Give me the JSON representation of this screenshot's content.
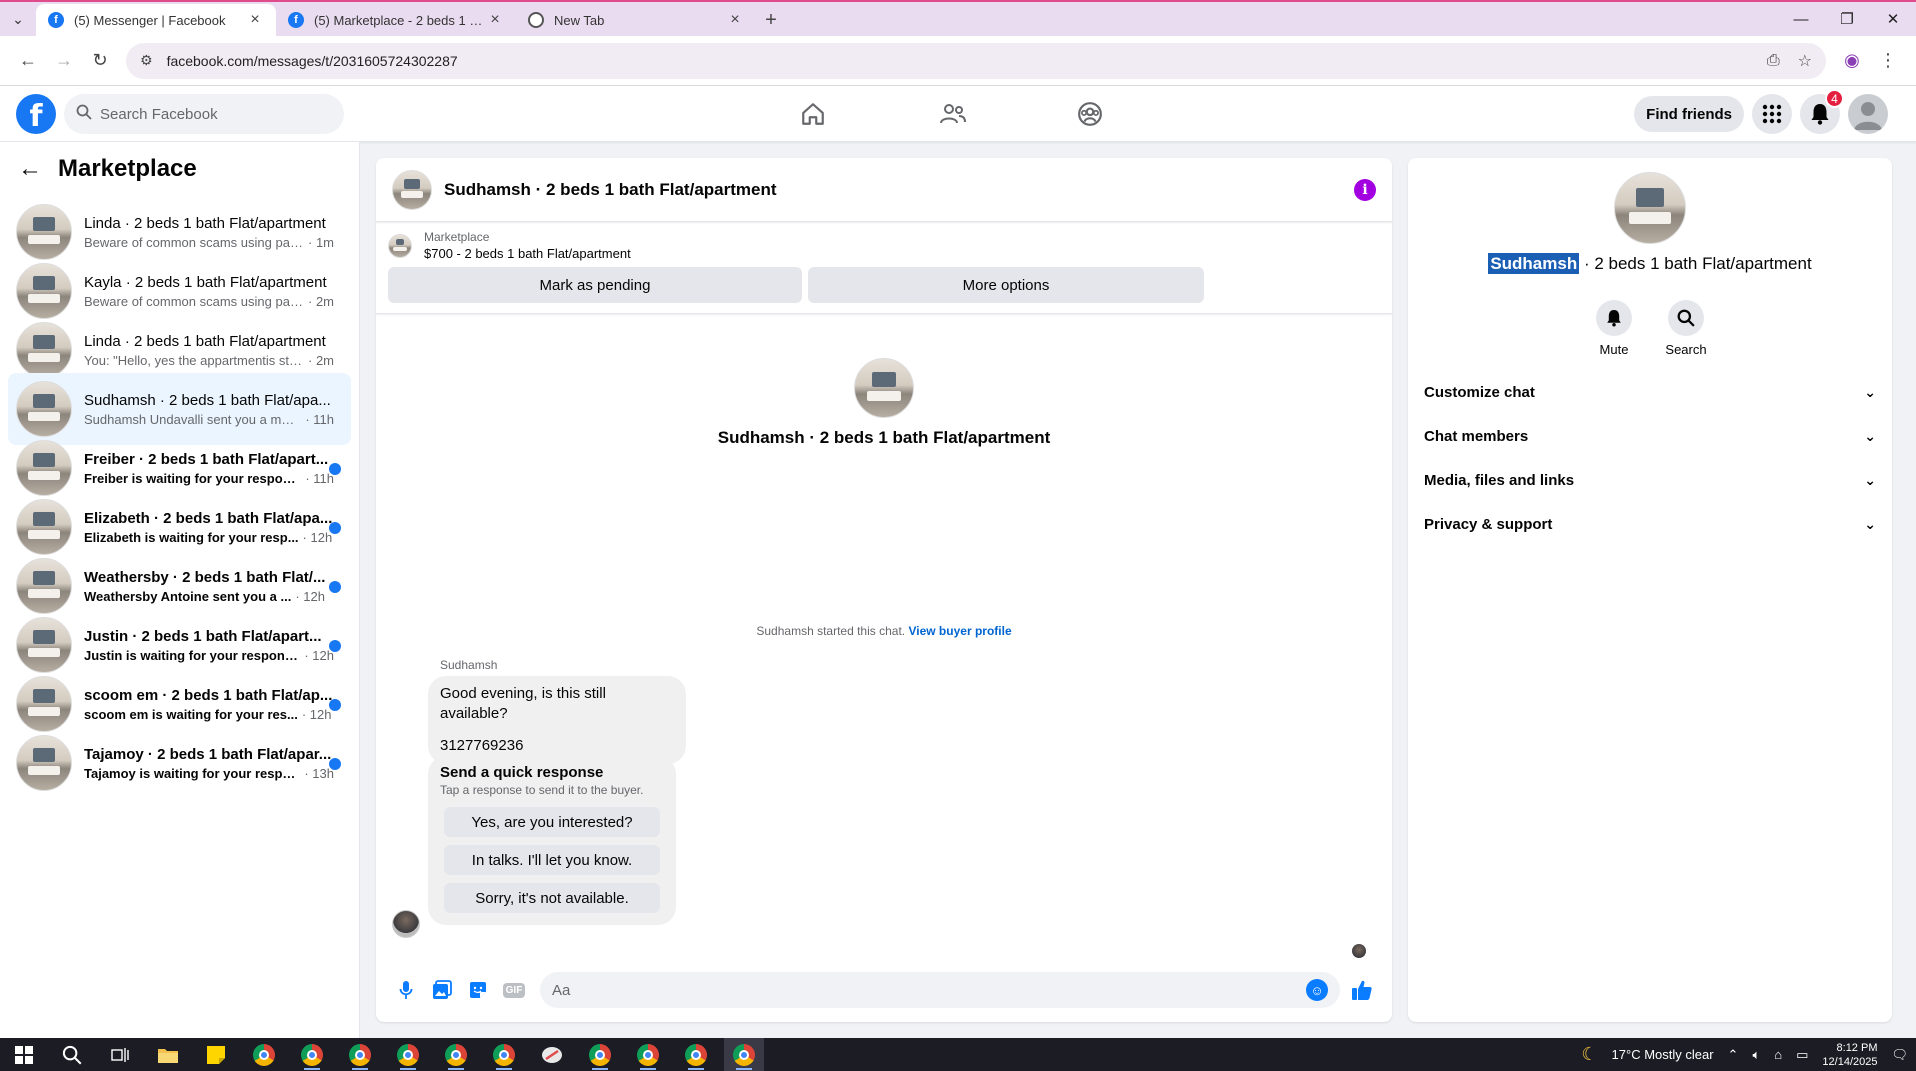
{
  "browser": {
    "tabs": [
      {
        "title": "(5) Messenger | Facebook",
        "active": true
      },
      {
        "title": "(5) Marketplace - 2 beds 1 bath",
        "active": false
      },
      {
        "title": "New Tab",
        "active": false
      }
    ],
    "url": "facebook.com/messages/t/2031605724302287"
  },
  "fb": {
    "search_placeholder": "Search Facebook",
    "find_friends": "Find friends",
    "notifications_count": "4"
  },
  "sidebar": {
    "title": "Marketplace",
    "conversations": [
      {
        "name": "Linda · 2 beds 1 bath Flat/apartment",
        "preview": "Beware of common scams using pay...",
        "time": "· 1m",
        "unread": false,
        "active": false
      },
      {
        "name": "Kayla · 2 beds 1 bath Flat/apartment",
        "preview": "Beware of common scams using pay...",
        "time": "· 2m",
        "unread": false,
        "active": false
      },
      {
        "name": "Linda · 2 beds 1 bath Flat/apartment",
        "preview": "You: \"Hello, yes the appartmentis still...",
        "time": "· 2m",
        "unread": false,
        "active": false
      },
      {
        "name": "Sudhamsh · 2 beds 1 bath Flat/apa...",
        "preview": "Sudhamsh Undavalli sent you a mess...",
        "time": "· 11h",
        "unread": false,
        "active": true
      },
      {
        "name": "Freiber · 2 beds 1 bath Flat/apart...",
        "preview": "Freiber is waiting for your respon...",
        "time": "· 11h",
        "unread": true,
        "active": false
      },
      {
        "name": "Elizabeth · 2 beds 1 bath Flat/apa...",
        "preview": "Elizabeth is waiting for your resp...",
        "time": "· 12h",
        "unread": true,
        "active": false
      },
      {
        "name": "Weathersby · 2 beds 1 bath Flat/...",
        "preview": "Weathersby Antoine sent you a ...",
        "time": "· 12h",
        "unread": true,
        "active": false
      },
      {
        "name": "Justin · 2 beds 1 bath Flat/apart...",
        "preview": "Justin is waiting for your response.",
        "time": "· 12h",
        "unread": true,
        "active": false
      },
      {
        "name": "scoom em · 2 beds 1 bath Flat/ap...",
        "preview": "scoom em is waiting for your res...",
        "time": "· 12h",
        "unread": true,
        "active": false
      },
      {
        "name": "Tajamoy · 2 beds 1 bath Flat/apar...",
        "preview": "Tajamoy is waiting for your respo...",
        "time": "· 13h",
        "unread": true,
        "active": false
      }
    ]
  },
  "chat": {
    "title": "Sudhamsh · 2 beds 1 bath Flat/apartment",
    "marketplace_label": "Marketplace",
    "listing": "$700 - 2 beds 1 bath Flat/apartment",
    "mark_pending": "Mark as pending",
    "more_options": "More options",
    "intro_title": "Sudhamsh · 2 beds 1 bath Flat/apartment",
    "started_text": "Sudhamsh started this chat.",
    "view_profile": "View buyer profile",
    "sender": "Sudhamsh",
    "message_line1": "Good evening, is this still available?",
    "message_line2": "3127769236",
    "quick_title": "Send a quick response",
    "quick_sub": "Tap a response to send it to the buyer.",
    "quick_options": [
      "Yes, are you interested?",
      "In talks. I'll let you know.",
      "Sorry, it's not available."
    ],
    "composer_placeholder": "Aa",
    "gif_label": "GIF"
  },
  "info_panel": {
    "name_highlight": "Sudhamsh",
    "name_rest": " · 2 beds 1 bath Flat/apartment",
    "mute": "Mute",
    "search": "Search",
    "sections": [
      "Customize chat",
      "Chat members",
      "Media, files and links",
      "Privacy & support"
    ]
  },
  "taskbar": {
    "weather": "17°C  Mostly clear",
    "time": "8:12 PM",
    "date": "12/14/2025"
  },
  "colors": {
    "fb_blue": "#1877f2",
    "messenger_blue": "#0a7cff",
    "info_purple": "#a200e0",
    "active_row": "#ebf5ff",
    "selection": "#1a5fb4"
  }
}
